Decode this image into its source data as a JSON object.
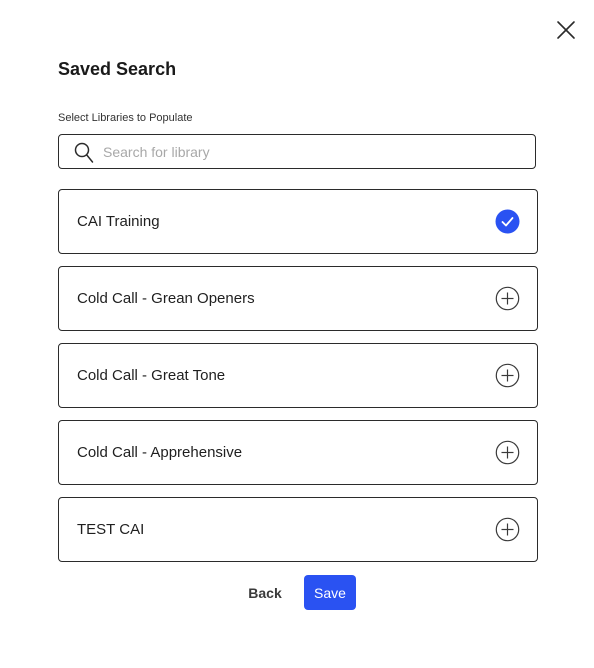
{
  "dialog": {
    "title": "Saved Search",
    "section_label": "Select Libraries to Populate"
  },
  "search": {
    "placeholder": "Search for library",
    "value": ""
  },
  "libraries": [
    {
      "label": "CAI Training",
      "selected": true,
      "icon": "check-circle-icon"
    },
    {
      "label": "Cold Call - Grean Openers",
      "selected": false,
      "icon": "plus-circle-icon"
    },
    {
      "label": "Cold Call - Great Tone",
      "selected": false,
      "icon": "plus-circle-icon"
    },
    {
      "label": "Cold Call - Apprehensive",
      "selected": false,
      "icon": "plus-circle-icon"
    },
    {
      "label": "TEST CAI",
      "selected": false,
      "icon": "plus-circle-icon"
    }
  ],
  "buttons": {
    "back_label": "Back",
    "save_label": "Save"
  },
  "colors": {
    "accent": "#2a52f2",
    "border": "#2b2b2b"
  }
}
